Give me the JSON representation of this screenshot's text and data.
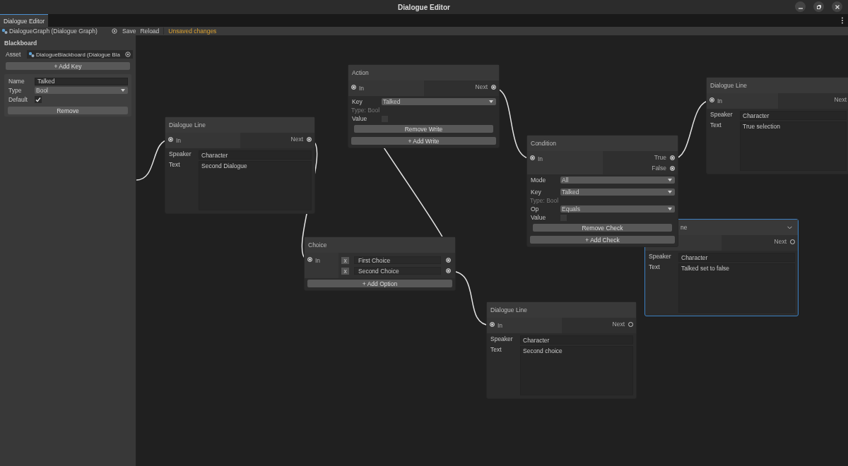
{
  "window": {
    "title": "Dialogue Editor"
  },
  "tabs": [
    {
      "label": "Dialogue Editor",
      "selected": true
    }
  ],
  "toolbar": {
    "graph_asset": "DialogueGraph (Dialogue Graph)",
    "buttons": [
      "Save",
      "Reload"
    ],
    "status": "Unsaved changes"
  },
  "blackboard": {
    "title": "Blackboard",
    "asset_label": "Asset",
    "asset": "DialogueBlackboard (Dialogue Bla",
    "add_key": "+ Add Key",
    "key": {
      "name_label": "Name",
      "name": "Talked",
      "type_label": "Type",
      "type": "Bool",
      "default_label": "Default",
      "default_checked": true,
      "remove": "Remove"
    }
  },
  "nodes": [
    {
      "kind": "dialogue_line",
      "title": "Dialogue Line",
      "selected": false,
      "in": {
        "label": "In",
        "connected": true
      },
      "outs": [
        {
          "label": "Next",
          "connected": true
        }
      ],
      "speaker_label": "Speaker",
      "speaker": "Character",
      "text_label": "Text",
      "text": "Second Dialogue"
    },
    {
      "kind": "action",
      "title": "Action",
      "selected": false,
      "in": {
        "label": "In",
        "connected": true
      },
      "outs": [
        {
          "label": "Next",
          "connected": true
        }
      ],
      "key_label": "Key",
      "key": "Talked",
      "type_info": "Type: Bool",
      "value_label": "Value",
      "value_checked": false,
      "remove": "Remove Write",
      "add": "+ Add Write"
    },
    {
      "kind": "condition",
      "title": "Condition",
      "selected": false,
      "in": {
        "label": "In",
        "connected": true
      },
      "outs": [
        {
          "label": "True",
          "connected": true
        },
        {
          "label": "False",
          "connected": true
        }
      ],
      "mode_label": "Mode",
      "mode": "All",
      "key_label": "Key",
      "key": "Talked",
      "type_info": "Type: Bool",
      "op_label": "Op",
      "op": "Equals",
      "value_label": "Value",
      "value_checked": false,
      "remove": "Remove Check",
      "add": "+ Add Check"
    },
    {
      "kind": "choice",
      "title": "Choice",
      "selected": false,
      "in": {
        "label": "In",
        "connected": true
      },
      "options": [
        {
          "remove": "x",
          "text": "First Choice",
          "connected": true
        },
        {
          "remove": "x",
          "text": "Second Choice",
          "connected": true
        }
      ],
      "add": "+ Add Option"
    },
    {
      "kind": "dialogue_line",
      "title": "Dialogue Line",
      "selected": false,
      "in": {
        "label": "In",
        "connected": true
      },
      "outs": [
        {
          "label": "Next",
          "connected": false
        }
      ],
      "speaker_label": "Speaker",
      "speaker": "Character",
      "text_label": "Text",
      "text": "Second choice"
    },
    {
      "kind": "dialogue_line",
      "title": "Dialogue Line",
      "selected": false,
      "in": {
        "label": "In",
        "connected": true
      },
      "outs": [
        {
          "label": "Next"
        }
      ],
      "speaker_label": "Speaker",
      "speaker": "Character",
      "text_label": "Text",
      "text": "True selection"
    },
    {
      "kind": "dialogue_line",
      "title": "ne",
      "selected": true,
      "collapsible": true,
      "outs": [
        {
          "label": "Next",
          "connected": false
        }
      ],
      "speaker_label": "Speaker",
      "speaker": "Character",
      "text_label": "Text",
      "text": "Talked set to false"
    }
  ]
}
